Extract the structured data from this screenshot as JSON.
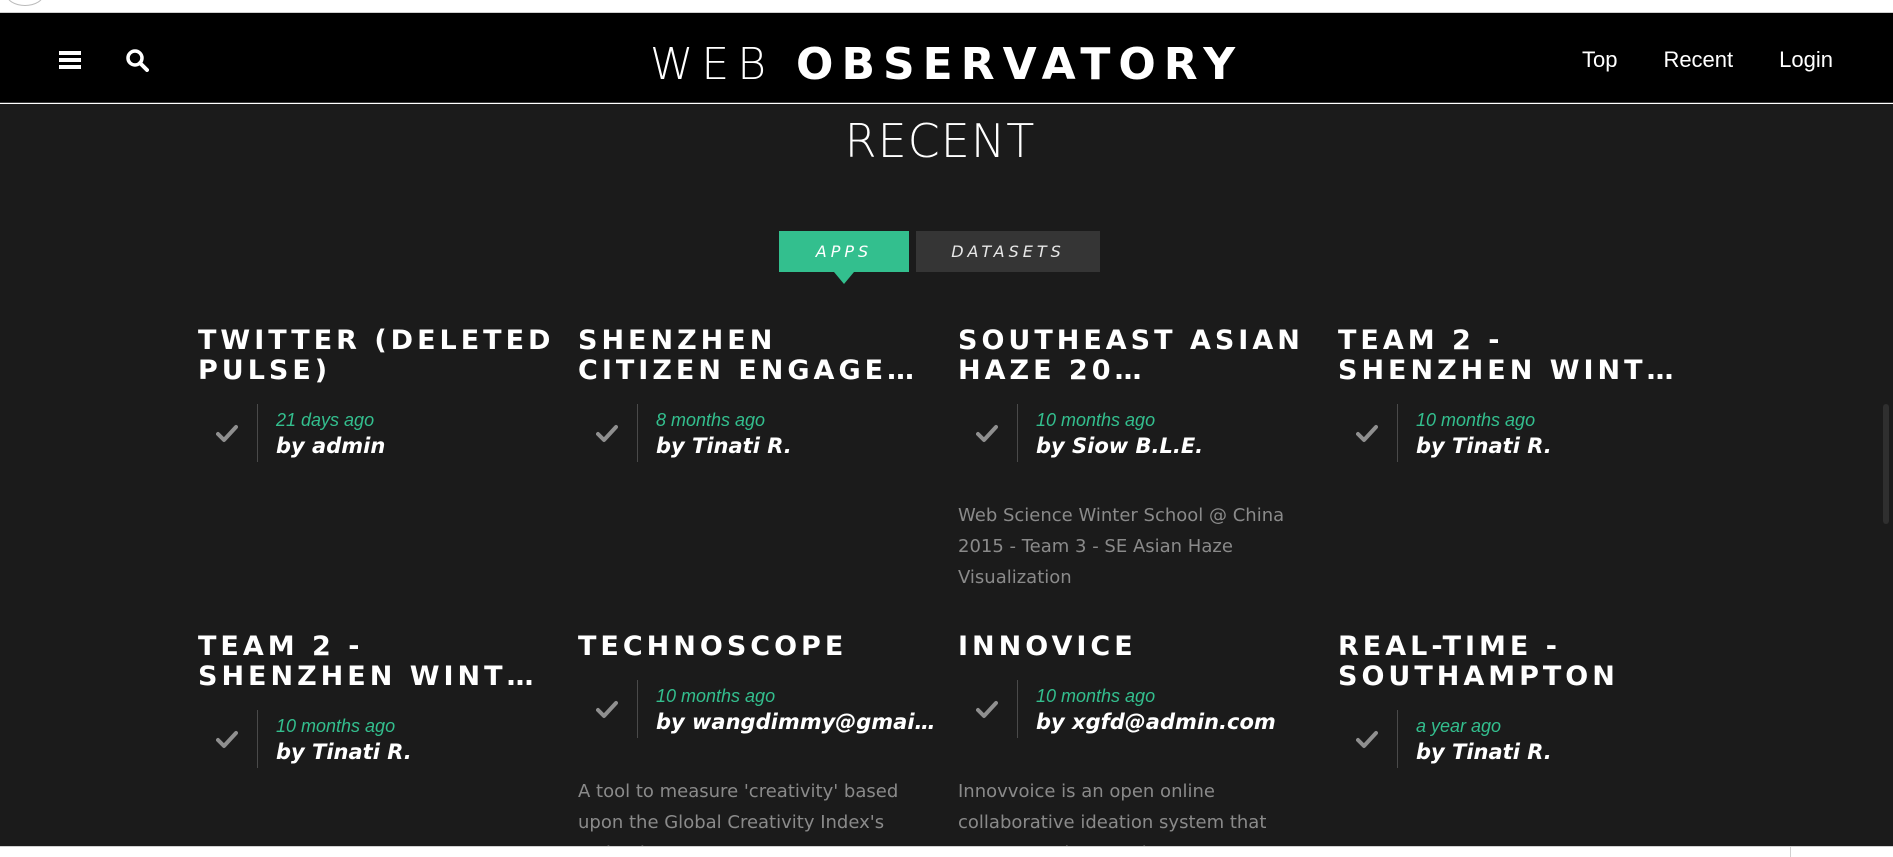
{
  "header": {
    "brand_light": "WEB",
    "brand_bold": "OBSERVATORY",
    "nav": [
      "Top",
      "Recent",
      "Login"
    ],
    "menu_icon": "hamburger-icon",
    "search_icon": "search-icon"
  },
  "page": {
    "title": "RECENT",
    "tabs": [
      "APPS",
      "DATASETS"
    ],
    "active_tab": "APPS"
  },
  "colors": {
    "accent": "#33bf8e",
    "background": "#1b1b1b",
    "navbar": "#000000"
  },
  "cards": [
    {
      "title": "TWITTER (DELETED PULSE)",
      "title_lines": [
        "TWITTER (DELETED",
        "PULSE)"
      ],
      "time": "21 days ago",
      "by": "by admin",
      "desc": ""
    },
    {
      "title": "SHENZHEN CITIZEN ENGAGE…",
      "title_lines": [
        "SHENZHEN",
        "CITIZEN ENGAGE…"
      ],
      "time": "8 months ago",
      "by": "by Tinati R.",
      "desc": ""
    },
    {
      "title": "SOUTHEAST ASIAN HAZE 20…",
      "title_lines": [
        "SOUTHEAST ASIAN",
        "HAZE 20…"
      ],
      "time": "10 months ago",
      "by": "by Siow B.L.E.",
      "desc": "Web Science Winter School @ China 2015 - Team 3 - SE Asian Haze Visualization"
    },
    {
      "title": "TEAM 2 - SHENZHEN WINT…",
      "title_lines": [
        "TEAM 2 -",
        "SHENZHEN WINT…"
      ],
      "time": "10 months ago",
      "by": "by Tinati R.",
      "desc": ""
    },
    {
      "title": "TEAM 2 - SHENZHEN WINT…",
      "title_lines": [
        "TEAM 2 -",
        "SHENZHEN WINT…"
      ],
      "time": "10 months ago",
      "by": "by Tinati R.",
      "desc": ""
    },
    {
      "title": "TECHNOSCOPE",
      "title_lines": [
        "TECHNOSCOPE"
      ],
      "time": "10 months ago",
      "by": "by wangdimmy@gmai…",
      "desc": "A tool to measure 'creativity' based upon the Global Creativity Index's technology"
    },
    {
      "title": "INNOVICE",
      "title_lines": [
        "INNOVICE"
      ],
      "time": "10 months ago",
      "by": "by xgfd@admin.com",
      "desc": "Innovvoice is an open online collaborative ideation system that empowers the crowd"
    },
    {
      "title": "REAL-TIME - SOUTHAMPTON",
      "title_lines": [
        "REAL-TIME -",
        "SOUTHAMPTON"
      ],
      "time": "a year ago",
      "by": "by Tinati R.",
      "desc": ""
    }
  ]
}
